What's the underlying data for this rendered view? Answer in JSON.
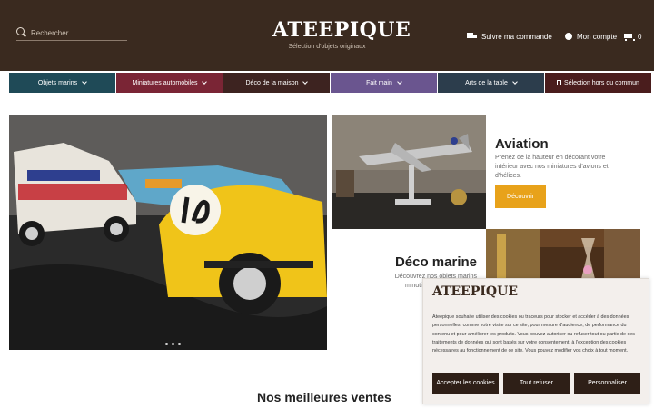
{
  "header": {
    "search_placeholder": "Rechercher",
    "logo": "ATEEPIQUE",
    "tagline": "Sélection d'objets originaux",
    "track_order": "Suivre ma commande",
    "account": "Mon compte",
    "cart_count": "0"
  },
  "nav": {
    "items": [
      {
        "label": "Objets marins",
        "bg": "#1f4a57"
      },
      {
        "label": "Miniatures automobiles",
        "bg": "#7a2535"
      },
      {
        "label": "Déco de la maison",
        "bg": "#3d2320"
      },
      {
        "label": "Fait main",
        "bg": "#6a558f"
      },
      {
        "label": "Arts de la table",
        "bg": "#2c3d4c"
      },
      {
        "label": "Sélection hors du commun",
        "bg": "#4a1d1d"
      }
    ]
  },
  "aviation": {
    "title": "Aviation",
    "description": "Prenez de la hauteur en décorant votre intérieur avec nos miniatures d'avions et d'hélices.",
    "button": "Découvrir"
  },
  "marine": {
    "title": "Déco marine",
    "description": "Découvrez nos objets marins minutieusement travaillés"
  },
  "best_sellers": {
    "title": "Nos meilleures ventes"
  },
  "cookie_banner": {
    "logo": "ATEEPIQUE",
    "text": "Ateepique souhaite utiliser des cookies ou traceurs pour stocker et accéder à des données personnelles, comme votre visite sur ce site, pour mesure d'audience, de performance du contenu et pour améliorer les produits. Vous pouvez autoriser ou refuser tout ou partie de ces traitements de données qui sont basés sur votre consentement, à l'exception des cookies nécessaires au fonctionnement de ce site. Vous pouvez modifier vos choix à tout moment.",
    "accept": "Accepter les cookies",
    "refuse": "Tout refuser",
    "customize": "Personnaliser"
  },
  "colors": {
    "header_bg": "#3a2a1f",
    "accent": "#e8a21a",
    "cookie_button": "#2e1f17"
  }
}
